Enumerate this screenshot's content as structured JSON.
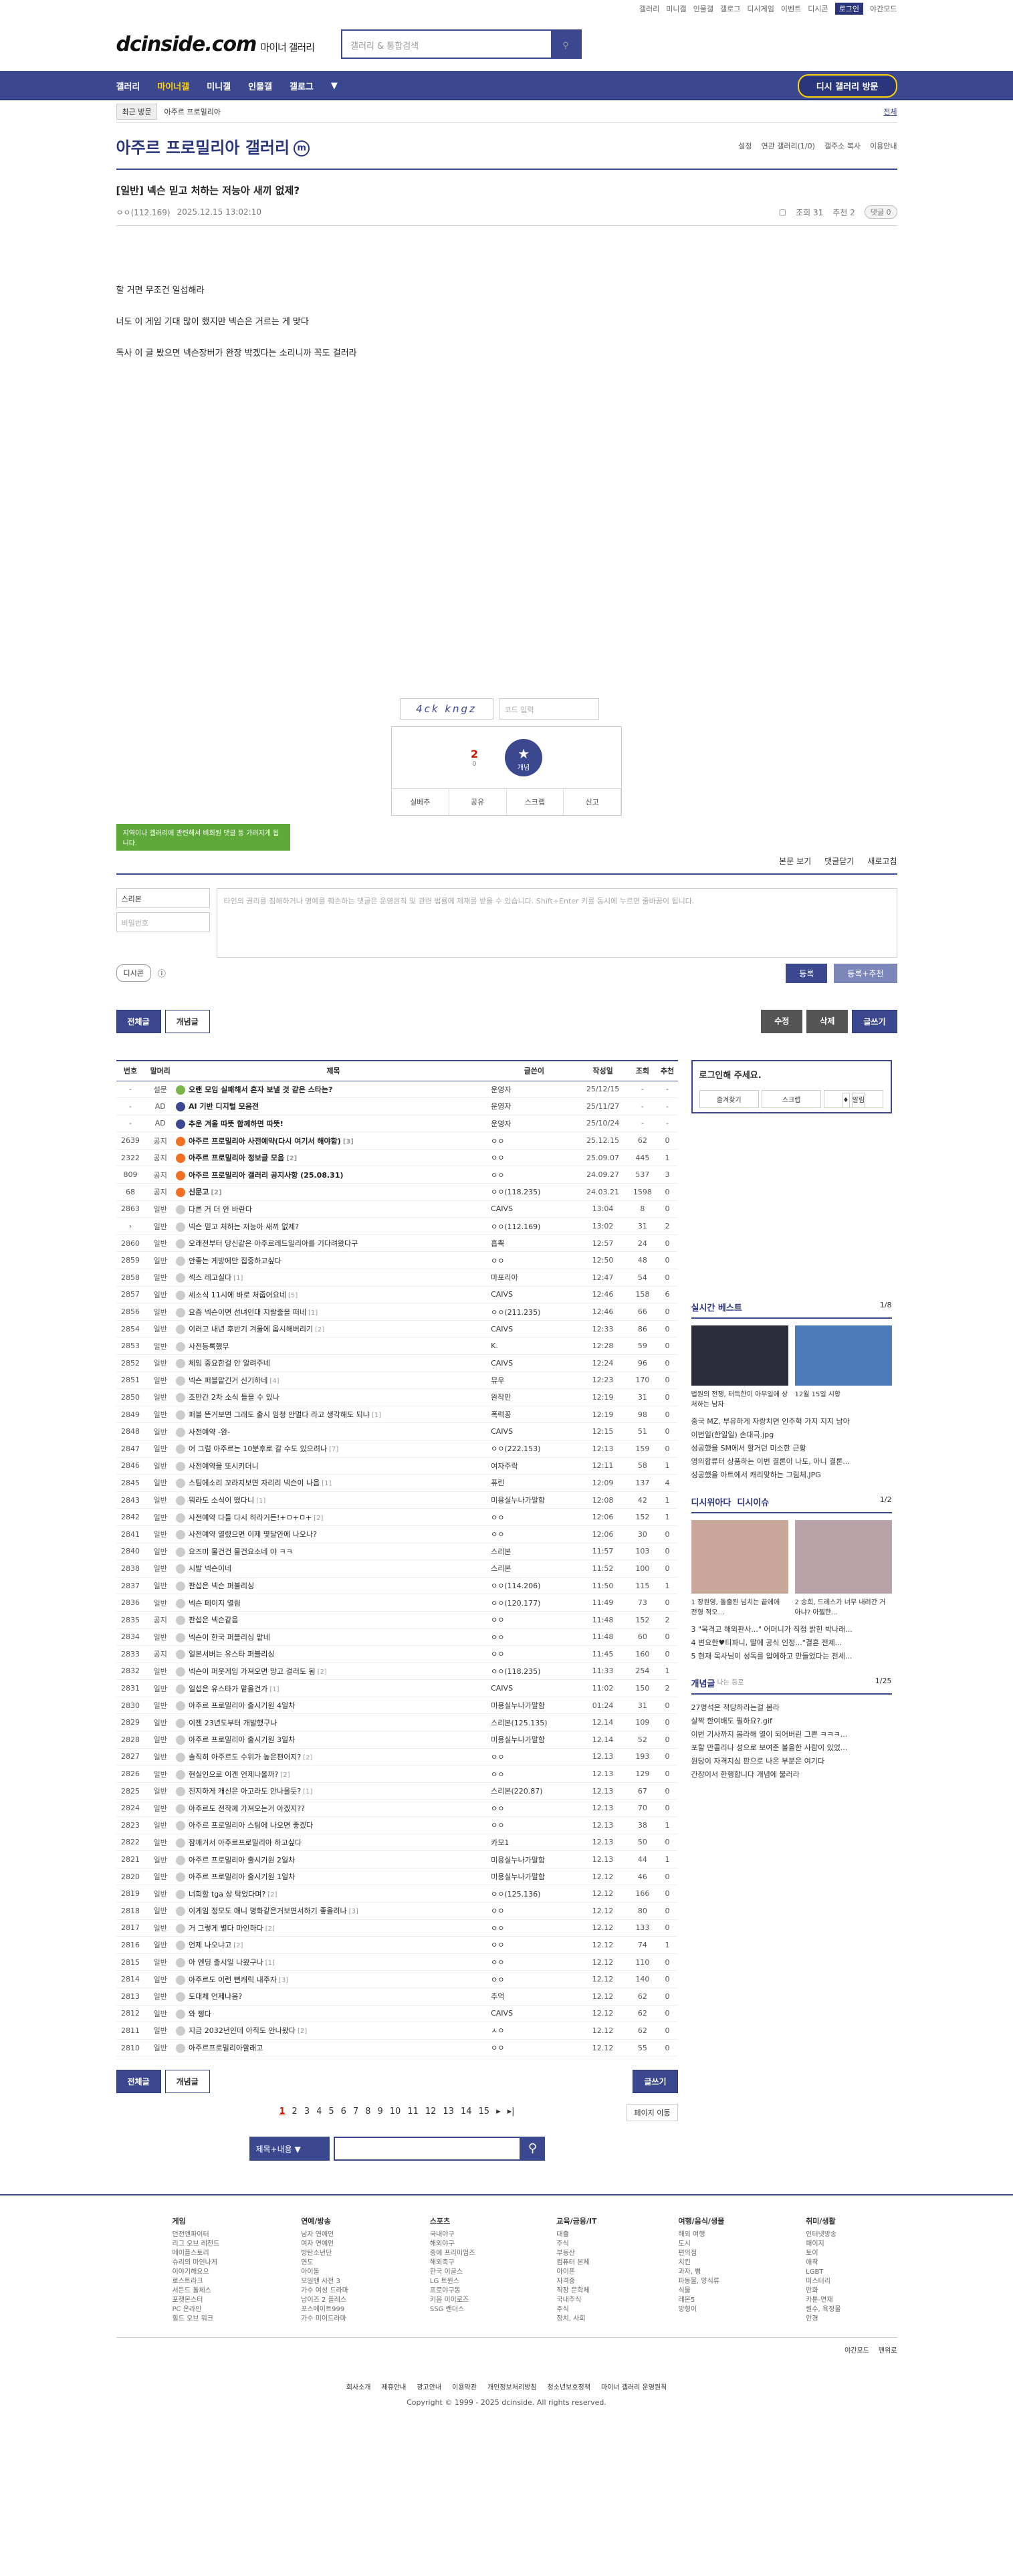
{
  "util": [
    "갤러리",
    "미니갤",
    "인물갤",
    "갤로그",
    "디시게임",
    "이벤트",
    "디시콘",
    "로그인",
    "야간모드"
  ],
  "logo": {
    "main": "dcinside.com",
    "sub": "마이너 갤러리"
  },
  "search": {
    "placeholder": "갤러리 & 통합검색"
  },
  "gnb": {
    "items": [
      "갤러리",
      "마이너갤",
      "미니갤",
      "인물갤",
      "갤로그"
    ],
    "revisit": "디시 갤러리 방문"
  },
  "visit": {
    "label": "최근 방문",
    "tag": "아주르 프로밀리아",
    "all": "전체"
  },
  "gallery": {
    "title": "아주르 프로밀리아 갤러리",
    "badge": "m",
    "links": [
      "설정",
      "연관 갤러리(1/0)",
      "갤주소 복사",
      "이용안내"
    ]
  },
  "post": {
    "title": "[일반] 넥슨 믿고 처하는 저능아 새끼 없제?",
    "author": "ㅇㅇ(112.169)",
    "date": "2025.12.15 13:02:10",
    "views": "조회 31",
    "recommend": "추천 2",
    "comments": "댓글 0",
    "lines": [
      "할 거면 무조건 일섭해라",
      "너도 이 게임 기대 많이 했지만 넥슨은 거르는 게 맞다",
      "독사 이 글 봤으면 넥슨장버가 완장 박겠다는 소리니까 꼭도 걸러라"
    ],
    "captcha": "4ck kngz",
    "captcha_ph": "코드 입력",
    "rec": {
      "count": "2",
      "fixed": "0",
      "label": "개념"
    },
    "actions": [
      "실베추",
      "공유",
      "스크랩",
      "신고"
    ]
  },
  "comments": {
    "tooltip": "지역이나 갤러리에 관련해서 비회원 댓글 등 가려지게 됩니다.",
    "tabs": [
      "본문 보기",
      "댓글닫기",
      "새로고침"
    ],
    "nick": "스리본",
    "pw_ph": "비밀번호",
    "placeholder": "타인의 권리를 침해하거나 명예를 훼손하는 댓글은 운영원칙 및 관련 법률에 제재를 받을 수 있습니다. Shift+Enter 키를 동시에 누르면 줄바꿈이 됩니다.",
    "dccon": "디시콘",
    "submit": "등록",
    "submit_rec": "등록+추천"
  },
  "board_btns": {
    "all": "전체글",
    "best": "개념글",
    "edit": "수정",
    "delete": "삭제",
    "write": "글쓰기"
  },
  "table": {
    "headers": [
      "번호",
      "말머리",
      "제목",
      "글쓴이",
      "작성일",
      "조회",
      "추천"
    ],
    "rows": [
      {
        "no": "-",
        "h": "설문",
        "t": "오랜 모임 실패해서 혼자 보낼 것 같은 스타는?",
        "c": "",
        "w": "운영자",
        "d": "25/12/15",
        "v": "-",
        "r": "-",
        "type": "survey",
        "notice": true
      },
      {
        "no": "-",
        "h": "AD",
        "t": "AI 기반 디지털 모음전",
        "c": "",
        "w": "운영자",
        "d": "25/11/27",
        "v": "-",
        "r": "-",
        "type": "ai",
        "notice": true
      },
      {
        "no": "-",
        "h": "AD",
        "t": "추운 겨울 따뜻 함께하면 따뜻!",
        "c": "",
        "w": "운영자",
        "d": "25/10/24",
        "v": "-",
        "r": "-",
        "type": "ai",
        "notice": true
      },
      {
        "no": "2639",
        "h": "공지",
        "t": "아주르 프로밀리아 사전예약(다시 여기서 해야함)",
        "c": "[3]",
        "w": "ㅇㅇ",
        "d": "25.12.15",
        "v": "62",
        "r": "0",
        "type": "notice",
        "notice": true
      },
      {
        "no": "2322",
        "h": "공지",
        "t": "아주르 프로밀리아 정보글 모음",
        "c": "[2]",
        "w": "ㅇㅇ",
        "d": "25.09.07",
        "v": "445",
        "r": "1",
        "type": "notice",
        "notice": true
      },
      {
        "no": "809",
        "h": "공지",
        "t": "아주르 프로밀리아 갤러리 공지사항 (25.08.31)",
        "c": "",
        "w": "ㅇㅇ",
        "d": "24.09.27",
        "v": "537",
        "r": "3",
        "type": "notice",
        "notice": true
      },
      {
        "no": "68",
        "h": "공지",
        "t": "신문고",
        "c": "[2]",
        "w": "ㅇㅇ(118.235)",
        "d": "24.03.21",
        "v": "1598",
        "r": "0",
        "type": "notice",
        "notice": true
      },
      {
        "no": "2863",
        "h": "일반",
        "t": "다른 거 더 안 바란다",
        "c": "",
        "w": "CAIVS",
        "d": "13:04",
        "v": "8",
        "r": "0",
        "type": "normal"
      },
      {
        "no": "›",
        "h": "일반",
        "t": "넥슨 믿고 처하는 저능아 새끼 없제?",
        "c": "",
        "w": "ㅇㅇ(112.169)",
        "d": "13:02",
        "v": "31",
        "r": "2",
        "type": "normal"
      },
      {
        "no": "2860",
        "h": "일반",
        "t": "오래전부터 당신같은 아주르레드일리아를 기다려왔다구",
        "c": "",
        "w": "흡뿍",
        "d": "12:57",
        "v": "24",
        "r": "0",
        "type": "normal"
      },
      {
        "no": "2859",
        "h": "일반",
        "t": "안좋는 게방에만 집중하고싶다",
        "c": "",
        "w": "ㅇㅇ",
        "d": "12:50",
        "v": "48",
        "r": "0",
        "type": "normal"
      },
      {
        "no": "2858",
        "h": "일반",
        "t": "섹스 레고실다",
        "c": "[1]",
        "w": "마포리아",
        "d": "12:47",
        "v": "54",
        "r": "0",
        "type": "normal"
      },
      {
        "no": "2857",
        "h": "일반",
        "t": "세소식 11시에 바로 처줍어요네",
        "c": "[5]",
        "w": "CAIVS",
        "d": "12:46",
        "v": "158",
        "r": "6",
        "type": "normal"
      },
      {
        "no": "2856",
        "h": "일반",
        "t": "요즘 넥슨이면 선녀인대 지랄줄을 떠네",
        "c": "[1]",
        "w": "ㅇㅇ(211.235)",
        "d": "12:46",
        "v": "66",
        "r": "0",
        "type": "normal"
      },
      {
        "no": "2854",
        "h": "일반",
        "t": "이러고 내년 후반기 겨울에 옵시해버리기",
        "c": "[2]",
        "w": "CAIVS",
        "d": "12:33",
        "v": "86",
        "r": "0",
        "type": "normal"
      },
      {
        "no": "2853",
        "h": "일반",
        "t": "사전등록했무",
        "c": "",
        "w": "K.",
        "d": "12:28",
        "v": "59",
        "r": "0",
        "type": "normal"
      },
      {
        "no": "2852",
        "h": "일반",
        "t": "체임 중요한걸 안 알려주네",
        "c": "",
        "w": "CAIVS",
        "d": "12:24",
        "v": "96",
        "r": "0",
        "type": "normal"
      },
      {
        "no": "2851",
        "h": "일반",
        "t": "넥슨 퍼블맡긴거 신기하네",
        "c": "[4]",
        "w": "뮤우",
        "d": "12:23",
        "v": "170",
        "r": "0",
        "type": "normal"
      },
      {
        "no": "2850",
        "h": "일반",
        "t": "조만간 2차 소식 들을 수 있나",
        "c": "",
        "w": "완작만",
        "d": "12:19",
        "v": "31",
        "r": "0",
        "type": "normal"
      },
      {
        "no": "2849",
        "h": "일반",
        "t": "퍼블 뜬거보면 그래도 출시 임청 안멀다 라고 생각해도 되냐",
        "c": "[1]",
        "w": "폭력꽁",
        "d": "12:19",
        "v": "98",
        "r": "0",
        "type": "normal"
      },
      {
        "no": "2848",
        "h": "일반",
        "t": "사전예약 -완-",
        "c": "",
        "w": "CAIVS",
        "d": "12:15",
        "v": "51",
        "r": "0",
        "type": "normal"
      },
      {
        "no": "2847",
        "h": "일반",
        "t": "어 그럼 아주르는 10분후로 갈 수도 있으려나",
        "c": "[7]",
        "w": "ㅇㅇ(222.153)",
        "d": "12:13",
        "v": "159",
        "r": "0",
        "type": "normal"
      },
      {
        "no": "2846",
        "h": "일반",
        "t": "사전예약을 또시키더니",
        "c": "",
        "w": "여자주락",
        "d": "12:11",
        "v": "58",
        "r": "1",
        "type": "normal"
      },
      {
        "no": "2845",
        "h": "일반",
        "t": "스팀에소리 꼬라지보면 자리리 넥슨이 나음",
        "c": "[1]",
        "w": "퓨린",
        "d": "12:09",
        "v": "137",
        "r": "4",
        "type": "normal"
      },
      {
        "no": "2843",
        "h": "일반",
        "t": "뭐라도 소식이 떴다니",
        "c": "[1]",
        "w": "미용실누나가말함",
        "d": "12:08",
        "v": "42",
        "r": "1",
        "type": "normal"
      },
      {
        "no": "2842",
        "h": "일반",
        "t": "사전예약 다들 다시 하라거든!+ㅁ+ㅁ+",
        "c": "[2]",
        "w": "ㅇㅇ",
        "d": "12:06",
        "v": "152",
        "r": "1",
        "type": "normal"
      },
      {
        "no": "2841",
        "h": "일반",
        "t": "사전예약 열렸으면 이제 몇달안에 나오나?",
        "c": "",
        "w": "ㅇㅇ",
        "d": "12:06",
        "v": "30",
        "r": "0",
        "type": "normal"
      },
      {
        "no": "2840",
        "h": "일반",
        "t": "요즈미 물건건 물건요소네 야 ㅋㅋ",
        "c": "",
        "w": "스리본",
        "d": "11:57",
        "v": "103",
        "r": "0",
        "type": "normal"
      },
      {
        "no": "2838",
        "h": "일반",
        "t": "시발 넥슨이네",
        "c": "",
        "w": "스리본",
        "d": "11:52",
        "v": "100",
        "r": "0",
        "type": "normal"
      },
      {
        "no": "2837",
        "h": "일반",
        "t": "판섭은 넥슨 퍼블리싱",
        "c": "",
        "w": "ㅇㅇ(114.206)",
        "d": "11:50",
        "v": "115",
        "r": "1",
        "type": "normal"
      },
      {
        "no": "2836",
        "h": "일반",
        "t": "넥슨 페이지 열림",
        "c": "",
        "w": "ㅇㅇ(120.177)",
        "d": "11:49",
        "v": "73",
        "r": "0",
        "type": "normal"
      },
      {
        "no": "2835",
        "h": "공지",
        "t": "판섭은 넥슨같음",
        "c": "",
        "w": "ㅇㅇ",
        "d": "11:48",
        "v": "152",
        "r": "2",
        "type": "normal"
      },
      {
        "no": "2834",
        "h": "일반",
        "t": "넥슨이 한국 퍼블리싱 맡네",
        "c": "",
        "w": "ㅇㅇ",
        "d": "11:48",
        "v": "60",
        "r": "0",
        "type": "normal"
      },
      {
        "no": "2833",
        "h": "공지",
        "t": "일본서버는 유스타 퍼블리싱",
        "c": "",
        "w": "ㅇㅇ",
        "d": "11:45",
        "v": "160",
        "r": "0",
        "type": "normal"
      },
      {
        "no": "2832",
        "h": "일반",
        "t": "넥슨이 퍼웃게임 가져오면 망고 걸러도 됨",
        "c": "[2]",
        "w": "ㅇㅇ(118.235)",
        "d": "11:33",
        "v": "254",
        "r": "1",
        "type": "normal"
      },
      {
        "no": "2831",
        "h": "일반",
        "t": "일섭은 유스타가 맡을건가",
        "c": "[1]",
        "w": "CAIVS",
        "d": "11:02",
        "v": "150",
        "r": "2",
        "type": "normal"
      },
      {
        "no": "2830",
        "h": "일반",
        "t": "아주르 프로밀리아 출시기원 4일차",
        "c": "",
        "w": "미용실누나가말함",
        "d": "01:24",
        "v": "31",
        "r": "0",
        "type": "normal"
      },
      {
        "no": "2829",
        "h": "일반",
        "t": "이젠 23년도부터 개발했구나",
        "c": "",
        "w": "스리본(125.135)",
        "d": "12.14",
        "v": "109",
        "r": "0",
        "type": "normal"
      },
      {
        "no": "2828",
        "h": "일반",
        "t": "아주르 프로밀리아 출시기원 3일차",
        "c": "",
        "w": "미용실누나가말함",
        "d": "12.14",
        "v": "52",
        "r": "0",
        "type": "normal"
      },
      {
        "no": "2827",
        "h": "일반",
        "t": "솔직히 아주르도 수위가 높은편이지?",
        "c": "[2]",
        "w": "ㅇㅇ",
        "d": "12.13",
        "v": "193",
        "r": "0",
        "type": "normal"
      },
      {
        "no": "2826",
        "h": "일반",
        "t": "현실인으로 이겐 언제나올까?",
        "c": "[2]",
        "w": "ㅇㅇ",
        "d": "12.13",
        "v": "129",
        "r": "0",
        "type": "normal"
      },
      {
        "no": "2825",
        "h": "일반",
        "t": "진지하게 캐신은 아고라도 안나올듯?",
        "c": "[1]",
        "w": "스리본(220.87)",
        "d": "12.13",
        "v": "67",
        "r": "0",
        "type": "normal"
      },
      {
        "no": "2824",
        "h": "일반",
        "t": "아주르도 전작께 가져오는거 아겠지??",
        "c": "",
        "w": "ㅇㅇ",
        "d": "12.13",
        "v": "70",
        "r": "0",
        "type": "normal"
      },
      {
        "no": "2823",
        "h": "일반",
        "t": "아주르 프로밀리아 스팀에 나오면 좋겠다",
        "c": "",
        "w": "ㅇㅇ",
        "d": "12.13",
        "v": "38",
        "r": "1",
        "type": "normal"
      },
      {
        "no": "2822",
        "h": "일반",
        "t": "잠깨거서 아주르프로밀리아 하고싶다",
        "c": "",
        "w": "카모1",
        "d": "12.13",
        "v": "50",
        "r": "0",
        "type": "normal"
      },
      {
        "no": "2821",
        "h": "일반",
        "t": "아주르 프로밀리아 출시기원 2일차",
        "c": "",
        "w": "미용실누나가말함",
        "d": "12.13",
        "v": "44",
        "r": "1",
        "type": "normal"
      },
      {
        "no": "2820",
        "h": "일반",
        "t": "아주르 프로밀리아 출시기원 1일차",
        "c": "",
        "w": "미용실누나가말함",
        "d": "12.12",
        "v": "46",
        "r": "0",
        "type": "normal"
      },
      {
        "no": "2819",
        "h": "일반",
        "t": "너희할 tga 상 탁었다며?",
        "c": "[2]",
        "w": "ㅇㅇ(125.136)",
        "d": "12.12",
        "v": "166",
        "r": "0",
        "type": "normal"
      },
      {
        "no": "2818",
        "h": "일반",
        "t": "이게임 정모도 애니 명화같은거보면서하기 좋을려나",
        "c": "[3]",
        "w": "ㅇㅇ",
        "d": "12.12",
        "v": "80",
        "r": "0",
        "type": "normal"
      },
      {
        "no": "2817",
        "h": "일반",
        "t": "거 그렇게 별다 마인하다",
        "c": "[2]",
        "w": "ㅇㅇ",
        "d": "12.12",
        "v": "133",
        "r": "0",
        "type": "normal"
      },
      {
        "no": "2816",
        "h": "일반",
        "t": "언제 나오냐고",
        "c": "[2]",
        "w": "ㅇㅇ",
        "d": "12.12",
        "v": "74",
        "r": "1",
        "type": "normal"
      },
      {
        "no": "2815",
        "h": "일반",
        "t": "아 엔딩 출시일 나왔구나",
        "c": "[1]",
        "w": "ㅇㅇ",
        "d": "12.12",
        "v": "110",
        "r": "0",
        "type": "normal"
      },
      {
        "no": "2814",
        "h": "일반",
        "t": "아주르도 이런 뻔캐릭 내주자",
        "c": "[3]",
        "w": "ㅇㅇ",
        "d": "12.12",
        "v": "140",
        "r": "0",
        "type": "normal"
      },
      {
        "no": "2813",
        "h": "일반",
        "t": "도대체 언제나옴?",
        "c": "",
        "w": "추억",
        "d": "12.12",
        "v": "62",
        "r": "0",
        "type": "normal"
      },
      {
        "no": "2812",
        "h": "일반",
        "t": "와 쩡다",
        "c": "",
        "w": "CAIVS",
        "d": "12.12",
        "v": "62",
        "r": "0",
        "type": "normal"
      },
      {
        "no": "2811",
        "h": "일반",
        "t": "지금 2032년인데 아직도 안나왔다",
        "c": "[2]",
        "w": "ㅅㅇ",
        "d": "12.12",
        "v": "62",
        "r": "0",
        "type": "normal"
      },
      {
        "no": "2810",
        "h": "일반",
        "t": "아주르프로밀리아할래고",
        "c": "",
        "w": "ㅇㅇ",
        "d": "12.12",
        "v": "55",
        "r": "0",
        "type": "normal"
      }
    ]
  },
  "side": {
    "login": {
      "title": "로그인해 주세요.",
      "btns": [
        "즐겨찾기",
        "스크랩",
        "알림"
      ]
    },
    "best": {
      "title": "실시간 베스트",
      "page": "1/8",
      "caps": [
        "법원의 전쟁, 터득한이 아무일에 상처하는 남자",
        "12월 15일 시황"
      ],
      "items": [
        "중국 MZ, 부유하게 자랑치면 인주혁 가지 지지 남아",
        "이번일(한일일) 손대극.jpg",
        "성공했을 SM에서 할거던 미소한 근황",
        "영의합류터 상품하는 이번 결론이 나도, 아니 결론...",
        "성공했을 아트에서 캐리맞하는 그림체.JPG"
      ]
    },
    "issue": {
      "title": "디시위아다",
      "title2": "디시이슈",
      "page": "1/2",
      "caps": [
        "1 장원영, 돌출된 넘치는 끝에에 전형 적오...",
        "2 송희, 드레스가 너무 내려간 거 아냐? 아찔한..."
      ],
      "items": [
        "3 \"목격고 해외판사...\" 어머니가 직접 밝힌 박나래...",
        "4 변요한♥티파니, 딸에 공식 인정...\"결혼 전제...",
        "5 현재 목사님이 성독를 압에하고 만들었다는 전세..."
      ]
    },
    "concept": {
      "title": "개념글",
      "sub": "나는 등로",
      "page": "1/25",
      "items": [
        "27명석은 적당하라는걸 봄라",
        "살짝 한여배도 필하요?.gif",
        "이번 기사까지 봄라해 열이 되어버린 그쁜 ㅋㅋㅋ...",
        "포할 만콜리나 성으로 보여준 볼을한 사람이 있었...",
        "원당이 자격지심 판으로 나온 부분은 여기다",
        "간장이서 한행합니다 개념에 물러라"
      ]
    }
  },
  "pager": {
    "pages": [
      "1",
      "2",
      "3",
      "4",
      "5",
      "6",
      "7",
      "8",
      "9",
      "10",
      "11",
      "12",
      "13",
      "14",
      "15"
    ],
    "move": "페이지 이동"
  },
  "bsearch": {
    "select": "제목+내용"
  },
  "footer": {
    "cols": [
      {
        "title": "게임",
        "items": [
          "던전앤파이터",
          "리그 오브 레전드",
          "메이플스토리",
          "슈리의 마인나게",
          "이야기해요으",
          "로스트라크",
          "서든드 돌체스",
          "포켓몬스터",
          "PC 온라인",
          "힐드 오브 워크"
        ]
      },
      {
        "title": "연예/방송",
        "items": [
          "남자 연예인",
          "여자 연예인",
          "방탄소년단",
          "연도",
          "아이돌",
          "모일밴 사전 3",
          "가수 여성 드라마",
          "남이즈 2 플레스",
          "포스메이트999",
          "가수 미이드라마"
        ]
      },
      {
        "title": "스포츠",
        "items": [
          "국내야구",
          "해외야구",
          "중에 프리미엄즈",
          "해외축구",
          "한국 이글스",
          "LG 트윈스",
          "프로야구동",
          "키움 미이로즈",
          "SSG 랜더스"
        ]
      },
      {
        "title": "교육/금융/IT",
        "items": [
          "대출",
          "주식",
          "부동산",
          "컴퓨터 본체",
          "아이폰",
          "자격증",
          "직장 문학체",
          "국내주식",
          "주식",
          "정치, 사회"
        ]
      },
      {
        "title": "여행/음식/생물",
        "items": [
          "해외 여행",
          "도시",
          "편의점",
          "치킨",
          "과자, 빵",
          "파동물, 양식류",
          "식물",
          "레몬5",
          "방형이"
        ]
      },
      {
        "title": "취미/생활",
        "items": [
          "인터넷방송",
          "패이지",
          "토이",
          "애착",
          "LGBT",
          "미스터리",
          "만화",
          "카툰-연재",
          "원수, 육정물",
          "안경"
        ]
      }
    ],
    "bar": [
      "야간모드",
      "맨위로"
    ],
    "links": [
      "회사소개",
      "제휴안내",
      "광고안내",
      "이용약관",
      "개인정보처리방침",
      "청소년보호정책",
      "마이너 갤러리 운영원칙"
    ],
    "copy": "Copyright © 1999 - 2025 dcinside. All rights reserved."
  }
}
